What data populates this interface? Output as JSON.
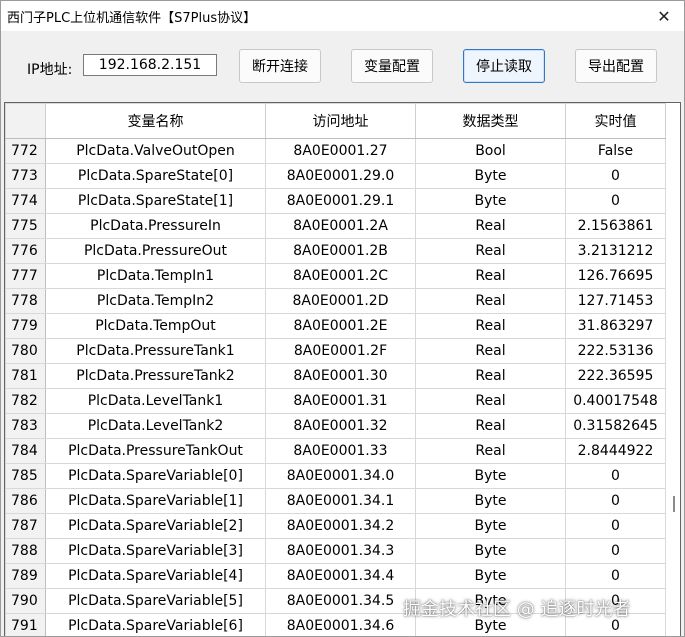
{
  "window": {
    "title": "西门子PLC上位机通信软件【S7Plus协议】",
    "close_glyph": "✕"
  },
  "toolbar": {
    "ip_label": "IP地址:",
    "ip_value": "192.168.2.151",
    "buttons": [
      {
        "label": "断开连接"
      },
      {
        "label": "变量配置"
      },
      {
        "label": "停止读取"
      },
      {
        "label": "导出配置"
      }
    ]
  },
  "table": {
    "columns": [
      "变量名称",
      "访问地址",
      "数据类型",
      "实时值"
    ],
    "rows": [
      {
        "no": "772",
        "name": "PlcData.ValveOutOpen",
        "address": "8A0E0001.27",
        "type": "Bool",
        "value": "False"
      },
      {
        "no": "773",
        "name": "PlcData.SpareState[0]",
        "address": "8A0E0001.29.0",
        "type": "Byte",
        "value": "0"
      },
      {
        "no": "774",
        "name": "PlcData.SpareState[1]",
        "address": "8A0E0001.29.1",
        "type": "Byte",
        "value": "0"
      },
      {
        "no": "775",
        "name": "PlcData.PressureIn",
        "address": "8A0E0001.2A",
        "type": "Real",
        "value": "2.1563861"
      },
      {
        "no": "776",
        "name": "PlcData.PressureOut",
        "address": "8A0E0001.2B",
        "type": "Real",
        "value": "3.2131212"
      },
      {
        "no": "777",
        "name": "PlcData.TempIn1",
        "address": "8A0E0001.2C",
        "type": "Real",
        "value": "126.76695"
      },
      {
        "no": "778",
        "name": "PlcData.TempIn2",
        "address": "8A0E0001.2D",
        "type": "Real",
        "value": "127.71453"
      },
      {
        "no": "779",
        "name": "PlcData.TempOut",
        "address": "8A0E0001.2E",
        "type": "Real",
        "value": "31.863297"
      },
      {
        "no": "780",
        "name": "PlcData.PressureTank1",
        "address": "8A0E0001.2F",
        "type": "Real",
        "value": "222.53136"
      },
      {
        "no": "781",
        "name": "PlcData.PressureTank2",
        "address": "8A0E0001.30",
        "type": "Real",
        "value": "222.36595"
      },
      {
        "no": "782",
        "name": "PlcData.LevelTank1",
        "address": "8A0E0001.31",
        "type": "Real",
        "value": "0.40017548"
      },
      {
        "no": "783",
        "name": "PlcData.LevelTank2",
        "address": "8A0E0001.32",
        "type": "Real",
        "value": "0.31582645"
      },
      {
        "no": "784",
        "name": "PlcData.PressureTankOut",
        "address": "8A0E0001.33",
        "type": "Real",
        "value": "2.8444922"
      },
      {
        "no": "785",
        "name": "PlcData.SpareVariable[0]",
        "address": "8A0E0001.34.0",
        "type": "Byte",
        "value": "0"
      },
      {
        "no": "786",
        "name": "PlcData.SpareVariable[1]",
        "address": "8A0E0001.34.1",
        "type": "Byte",
        "value": "0"
      },
      {
        "no": "787",
        "name": "PlcData.SpareVariable[2]",
        "address": "8A0E0001.34.2",
        "type": "Byte",
        "value": "0"
      },
      {
        "no": "788",
        "name": "PlcData.SpareVariable[3]",
        "address": "8A0E0001.34.3",
        "type": "Byte",
        "value": "0"
      },
      {
        "no": "789",
        "name": "PlcData.SpareVariable[4]",
        "address": "8A0E0001.34.4",
        "type": "Byte",
        "value": "0"
      },
      {
        "no": "790",
        "name": "PlcData.SpareVariable[5]",
        "address": "8A0E0001.34.5",
        "type": "Byte",
        "value": "0"
      },
      {
        "no": "791",
        "name": "PlcData.SpareVariable[6]",
        "address": "8A0E0001.34.6",
        "type": "Byte",
        "value": "0"
      }
    ]
  },
  "watermark": "掘金技术社区 @ 追逐时光者",
  "colors": {
    "window_bg": "#f0f0f0",
    "active_button_border": "#2f77c8",
    "row_header_bg": "#f2f2f2",
    "grid_line": "#d8d8d8"
  }
}
